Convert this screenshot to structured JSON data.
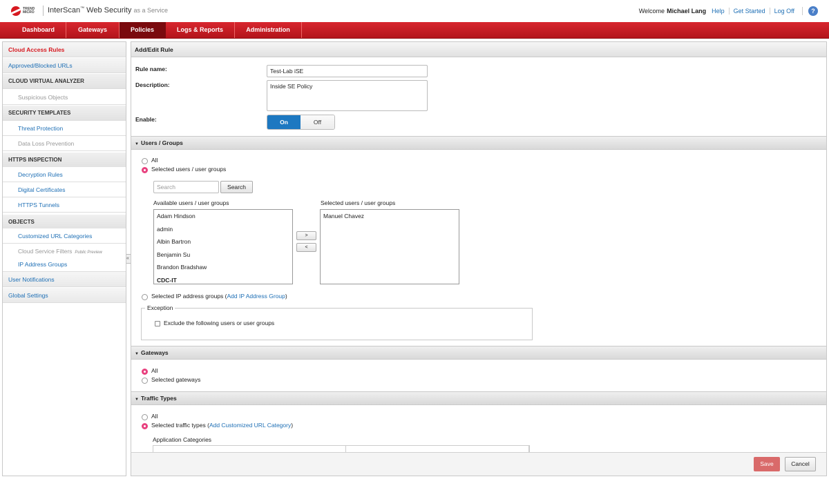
{
  "header": {
    "logo_text": "TREND MICRO",
    "product_name": "InterScan",
    "product_tm": "™",
    "product_rest": " Web Security",
    "product_suffix": "as a Service",
    "welcome_label": "Welcome",
    "user_name": "Michael Lang",
    "links": [
      "Help",
      "Get Started",
      "Log Off"
    ],
    "help_icon_glyph": "?"
  },
  "nav": {
    "tabs": [
      "Dashboard",
      "Gateways",
      "Policies",
      "Logs & Reports",
      "Administration"
    ],
    "active": "Policies"
  },
  "sidebar": {
    "items": [
      {
        "label": "Cloud Access Rules"
      },
      {
        "label": "Approved/Blocked URLs"
      },
      {
        "label": "CLOUD VIRTUAL ANALYZER"
      },
      {
        "label": "Suspicious Objects"
      },
      {
        "label": "SECURITY TEMPLATES"
      },
      {
        "label": "Threat Protection"
      },
      {
        "label": "Data Loss Prevention"
      },
      {
        "label": "HTTPS INSPECTION"
      },
      {
        "label": "Decryption Rules"
      },
      {
        "label": "Digital Certificates"
      },
      {
        "label": "HTTPS Tunnels"
      },
      {
        "label": "OBJECTS"
      },
      {
        "label": "Customized URL Categories"
      },
      {
        "label": "Cloud Service Filters",
        "tag": "Public Preview"
      },
      {
        "label": "IP Address Groups"
      },
      {
        "label": "User Notifications"
      },
      {
        "label": "Global Settings"
      }
    ],
    "collapse_glyph": "«"
  },
  "form": {
    "title": "Add/Edit Rule",
    "rule_name_label": "Rule name:",
    "rule_name_value": "Test-Lab iSE",
    "description_label": "Description:",
    "description_value": "Inside SE Policy",
    "enable_label": "Enable:",
    "toggle_on": "On",
    "toggle_off": "Off"
  },
  "users_groups": {
    "section_title": "Users / Groups",
    "caret": "▼",
    "opt_all": "All",
    "opt_selected": "Selected users / user groups",
    "search_placeholder": "Search",
    "search_button": "Search",
    "available_label": "Available users / user groups",
    "available": [
      "Adam Hindson",
      "admin",
      "Albin Bartron",
      "Benjamin Su",
      "Brandon Bradshaw",
      "CDC-IT"
    ],
    "selected_label": "Selected users / user groups",
    "selected": [
      "Manuel Chavez"
    ],
    "move_right": ">",
    "move_left": "<",
    "opt_ip_groups": "Selected IP address groups (",
    "add_ip_link": "Add IP Address Group",
    "close_paren": ")",
    "exception_legend": "Exception",
    "exclude_label": "Exclude the following users or user groups"
  },
  "gateways": {
    "section_title": "Gateways",
    "opt_all": "All",
    "opt_selected": "Selected gateways"
  },
  "traffic": {
    "section_title": "Traffic Types",
    "opt_all": "All",
    "opt_selected": "Selected traffic types (",
    "add_cat_link": "Add Customized URL Category",
    "close_paren": ")",
    "app_categories_label": "Application Categories"
  },
  "footer": {
    "save": "Save",
    "cancel": "Cancel"
  },
  "colors": {
    "brand_red": "#d71920",
    "link_blue": "#1e6fb5",
    "toggle_on_blue": "#1d78c1",
    "radio_selected": "#e8417f"
  }
}
